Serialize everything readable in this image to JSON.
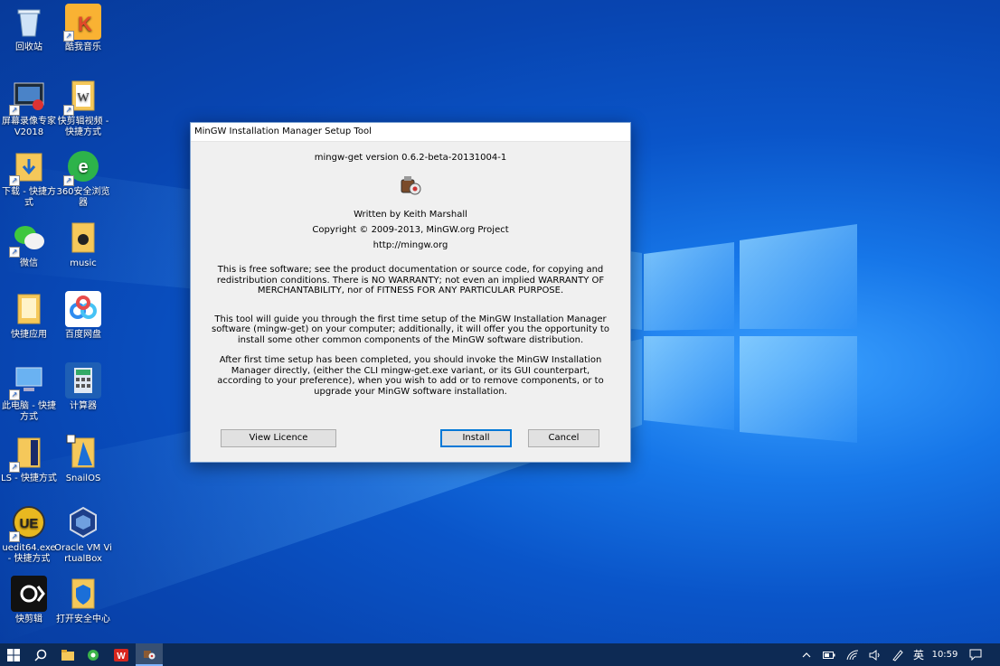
{
  "desktop": {
    "icons": [
      {
        "label": "回收站"
      },
      {
        "label": "酷我音乐"
      },
      {
        "label": "屏幕录像专家V2018"
      },
      {
        "label": "快剪辑视频 - 快捷方式"
      },
      {
        "label": "下载 - 快捷方式"
      },
      {
        "label": "360安全浏览器"
      },
      {
        "label": "微信"
      },
      {
        "label": "music"
      },
      {
        "label": "快捷应用"
      },
      {
        "label": "百度网盘"
      },
      {
        "label": "此电脑 - 快捷方式"
      },
      {
        "label": "计算器"
      },
      {
        "label": "LS - 快捷方式"
      },
      {
        "label": "SnailOS"
      },
      {
        "label": "uedit64.exe - 快捷方式"
      },
      {
        "label": "Oracle VM VirtualBox"
      },
      {
        "label": "快剪辑"
      },
      {
        "label": "打开安全中心"
      }
    ]
  },
  "dialog": {
    "title": "MinGW Installation Manager Setup Tool",
    "version": "mingw-get version 0.6.2-beta-20131004-1",
    "author": "Written by Keith Marshall",
    "copyright": "Copyright © 2009-2013, MinGW.org Project",
    "url": "http://mingw.org",
    "license_p1": "This is free software; see the product documentation or source code, for copying and",
    "license_p2": "redistribution conditions.  There is NO WARRANTY; not even an implied WARRANTY OF",
    "license_p3": "MERCHANTABILITY, nor of FITNESS FOR ANY PARTICULAR PURPOSE.",
    "guide_p1": "This tool will guide you through the first time setup of the MinGW Installation Manager",
    "guide_p2": "software (mingw-get) on your computer; additionally, it will offer you the opportunity to",
    "guide_p3": "install some other common components of the MinGW software distribution.",
    "after_p1": "After first time setup has been completed, you should invoke the MinGW Installation",
    "after_p2": "Manager directly, (either the CLI mingw-get.exe variant, or its GUI counterpart,",
    "after_p3": "according to your preference), when you wish to add or to remove components, or to",
    "after_p4": "upgrade your MinGW software installation.",
    "buttons": {
      "view_licence": "View Licence",
      "install": "Install",
      "cancel": "Cancel"
    }
  },
  "taskbar": {
    "ime": "英",
    "time": "10:59"
  }
}
